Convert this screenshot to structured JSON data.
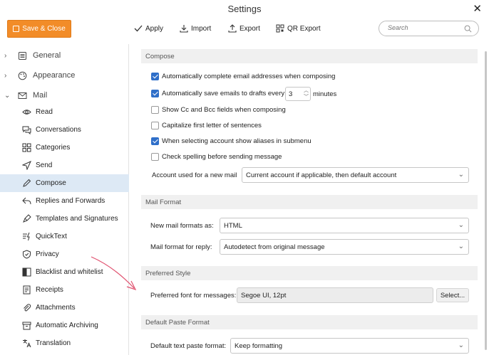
{
  "window": {
    "title": "Settings",
    "close_glyph": "✕"
  },
  "toolbar": {
    "save_label": "Save & Close",
    "apply_label": "Apply",
    "import_label": "Import",
    "export_label": "Export",
    "qr_export_label": "QR Export",
    "search_placeholder": "Search"
  },
  "sidebar": {
    "sections": [
      {
        "label": "General",
        "expanded": false,
        "icon": "list-icon"
      },
      {
        "label": "Appearance",
        "expanded": false,
        "icon": "palette-icon"
      },
      {
        "label": "Mail",
        "expanded": true,
        "icon": "envelope-icon"
      }
    ],
    "items": [
      {
        "label": "Read",
        "icon": "eye-icon"
      },
      {
        "label": "Conversations",
        "icon": "chat-icon"
      },
      {
        "label": "Categories",
        "icon": "grid-icon"
      },
      {
        "label": "Send",
        "icon": "send-icon"
      },
      {
        "label": "Compose",
        "icon": "pencil-icon",
        "active": true
      },
      {
        "label": "Replies and Forwards",
        "icon": "reply-icon"
      },
      {
        "label": "Templates and Signatures",
        "icon": "pen-icon"
      },
      {
        "label": "QuickText",
        "icon": "quicktext-icon"
      },
      {
        "label": "Privacy",
        "icon": "shield-icon"
      },
      {
        "label": "Blacklist and whitelist",
        "icon": "blacklist-icon"
      },
      {
        "label": "Receipts",
        "icon": "receipt-icon"
      },
      {
        "label": "Attachments",
        "icon": "paperclip-icon"
      },
      {
        "label": "Automatic Archiving",
        "icon": "archive-icon"
      },
      {
        "label": "Translation",
        "icon": "translate-icon"
      }
    ]
  },
  "compose": {
    "header": "Compose",
    "options": [
      {
        "label": "Automatically complete email addresses when composing",
        "checked": true
      },
      {
        "label": "Automatically save emails to drafts every",
        "checked": true,
        "value": "3",
        "suffix": "minutes"
      },
      {
        "label": "Show Cc and Bcc fields when composing",
        "checked": false
      },
      {
        "label": "Capitalize first letter of sentences",
        "checked": false
      },
      {
        "label": "When selecting account show aliases in submenu",
        "checked": true
      },
      {
        "label": "Check spelling before sending message",
        "checked": false
      }
    ],
    "account_label": "Account used for a new mail",
    "account_value": "Current account if applicable, then default account"
  },
  "mail_format": {
    "header": "Mail Format",
    "new_label": "New mail formats as:",
    "new_value": "HTML",
    "reply_label": "Mail format for reply:",
    "reply_value": "Autodetect from original message"
  },
  "preferred_style": {
    "header": "Preferred Style",
    "font_label": "Preferred font for messages:",
    "font_value": "Segoe UI, 12pt",
    "select_label": "Select..."
  },
  "paste_format": {
    "header": "Default Paste Format",
    "label": "Default text paste format:",
    "value": "Keep formatting"
  },
  "colors": {
    "accent": "#f28c28",
    "checkbox": "#2f6fc9",
    "active_item": "#dde9f5",
    "annotation_arrow": "#e0506e"
  }
}
